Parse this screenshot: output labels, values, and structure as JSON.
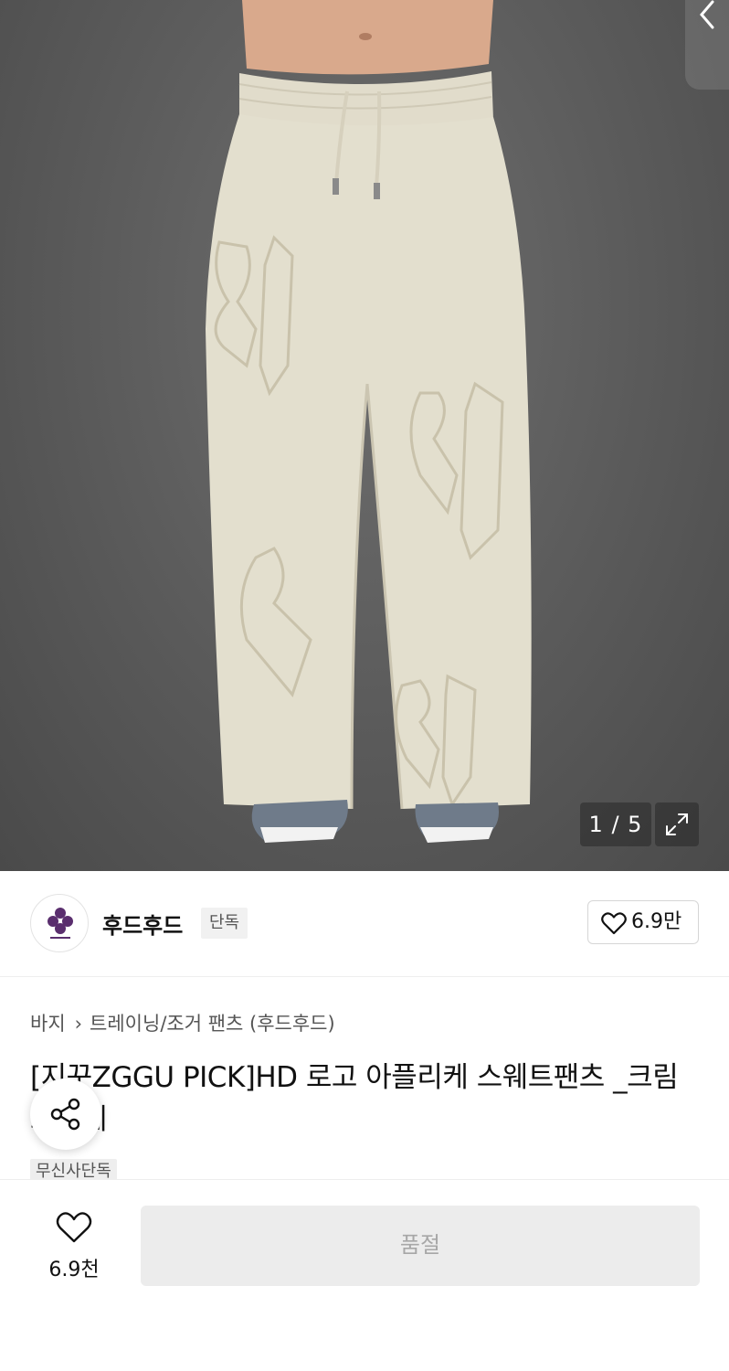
{
  "image_viewer": {
    "counter": "1 / 5",
    "icons": [
      "back-chevron-icon",
      "expand-icon"
    ]
  },
  "brand": {
    "name": "후드후드",
    "tag": "단독",
    "likes": "6.9만"
  },
  "product": {
    "breadcrumb": [
      "바지",
      "트레이닝/조거 팬츠 (후드후드)"
    ],
    "title": "[지꾸ZGGU PICK]HD 로고 아플리케 스웨트팬츠 _크림브륄레",
    "chip": "무신사단독"
  },
  "bottom_bar": {
    "wish_count": "6.9천",
    "soldout_label": "품절"
  },
  "colors": {
    "soldout_bg": "#ececec",
    "soldout_text": "#a7a7a7",
    "brand_logo": "#5a2e6e"
  }
}
